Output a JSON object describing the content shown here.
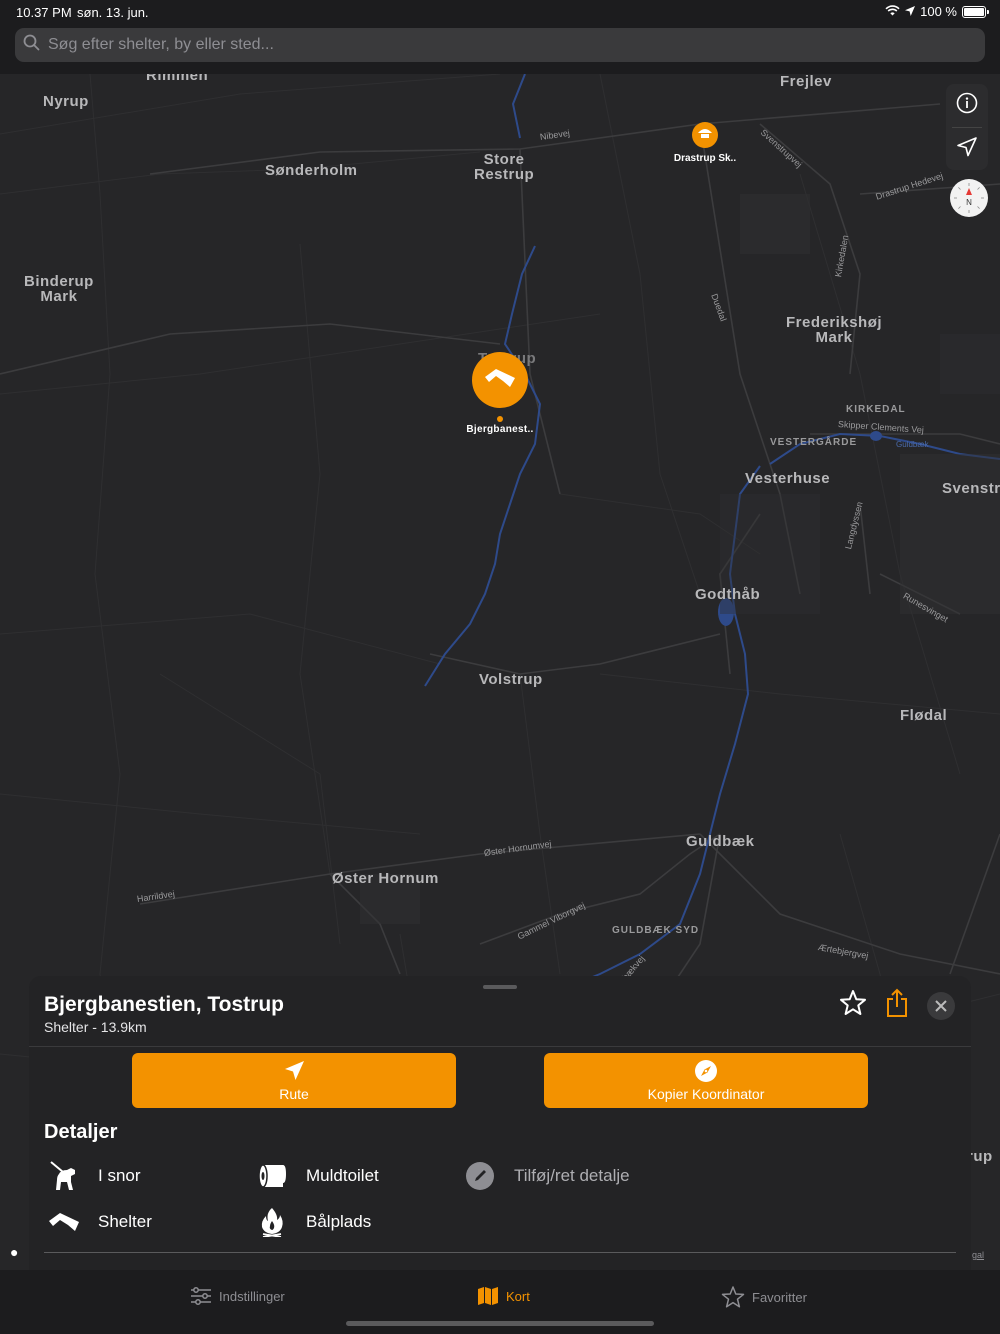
{
  "status_bar": {
    "time": "10.37 PM",
    "date": "søn. 13. jun.",
    "battery": "100 %"
  },
  "search": {
    "placeholder": "Søg efter shelter, by eller sted..."
  },
  "map": {
    "places": [
      {
        "id": "rimmen",
        "name": "Rimmen"
      },
      {
        "id": "nyrup",
        "name": "Nyrup"
      },
      {
        "id": "frejlev",
        "name": "Frejlev"
      },
      {
        "id": "sonderholm",
        "name": "Sønderholm"
      },
      {
        "id": "store-restrup",
        "name": "Store\nRestrup"
      },
      {
        "id": "binderup-mark",
        "name": "Binderup\nMark"
      },
      {
        "id": "frederikshoj-mark",
        "name": "Frederikshøj\nMark"
      },
      {
        "id": "tostrup",
        "name": "Tostrup"
      },
      {
        "id": "vesterhuse",
        "name": "Vesterhuse"
      },
      {
        "id": "svenstrup",
        "name": "Svenstr"
      },
      {
        "id": "godthab",
        "name": "Godthåb"
      },
      {
        "id": "volstrup",
        "name": "Volstrup"
      },
      {
        "id": "flodal",
        "name": "Flødal"
      },
      {
        "id": "guldbaek",
        "name": "Guldbæk"
      },
      {
        "id": "oster-hornum",
        "name": "Øster Hornum"
      },
      {
        "id": "rup",
        "name": "rup"
      }
    ],
    "districts": [
      {
        "id": "kirkedal",
        "name": "KIRKEDAL"
      },
      {
        "id": "vestergarde",
        "name": "VESTERGÅRDE"
      },
      {
        "id": "guldbaek-syd",
        "name": "GULDBÆK SYD"
      }
    ],
    "roads": [
      {
        "id": "nibevej",
        "name": "Nibevej"
      },
      {
        "id": "svenstrupvej",
        "name": "Svenstrupvej"
      },
      {
        "id": "drastrup-hedevej",
        "name": "Drastrup Hedevej"
      },
      {
        "id": "kirkedalen",
        "name": "Kirkedalen"
      },
      {
        "id": "duedal",
        "name": "Duedal"
      },
      {
        "id": "skipper-clements-vej",
        "name": "Skipper Clements Vej"
      },
      {
        "id": "guldbaek-road",
        "name": "Guldbæk"
      },
      {
        "id": "langdyssen",
        "name": "Langdyssen"
      },
      {
        "id": "runesvinget",
        "name": "Runesvinget"
      },
      {
        "id": "oster-hornumvej",
        "name": "Øster Hornumvej"
      },
      {
        "id": "harrildvej",
        "name": "Harrildvej"
      },
      {
        "id": "gammel-viborgvej",
        "name": "Gammel Viborgvej"
      },
      {
        "id": "aertebjergvej",
        "name": "Ærtebjergvej"
      },
      {
        "id": "baekvej",
        "name": "bækvej"
      }
    ],
    "pins": [
      {
        "id": "bjergbanestien",
        "label": "Bjergbanest..",
        "selected": true,
        "icon": "shelter-icon"
      },
      {
        "id": "drastrup",
        "label": "Drastrup Sk..",
        "selected": false,
        "icon": "shelter-roof-icon"
      }
    ],
    "compass_letter": "N",
    "edge_labels": {
      "apple_maps": "",
      "legal": "gal"
    }
  },
  "sheet": {
    "title": "Bjergbanestien, Tostrup",
    "subtitle": "Shelter - 13.9km",
    "route_label": "Rute",
    "copy_label": "Kopier Koordinator",
    "details_heading": "Detaljer",
    "details": [
      {
        "id": "leash",
        "label": "I snor",
        "icon": "dog-leash-icon"
      },
      {
        "id": "toilet",
        "label": "Muldtoilet",
        "icon": "toilet-paper-icon"
      },
      {
        "id": "add",
        "label": "Tilføj/ret detalje",
        "icon": "pencil-icon",
        "muted": true
      },
      {
        "id": "shelter",
        "label": "Shelter",
        "icon": "shelter-icon"
      },
      {
        "id": "fire",
        "label": "Bålplads",
        "icon": "fire-icon"
      }
    ]
  },
  "tabbar": {
    "tabs": [
      {
        "id": "settings",
        "label": "Indstillinger",
        "active": false
      },
      {
        "id": "map",
        "label": "Kort",
        "active": true
      },
      {
        "id": "favorites",
        "label": "Favoritter",
        "active": false
      }
    ]
  },
  "colors": {
    "accent": "#f39200",
    "map_bg": "#262628",
    "water": "#2e4a8a",
    "road": "#3c3c3e"
  }
}
